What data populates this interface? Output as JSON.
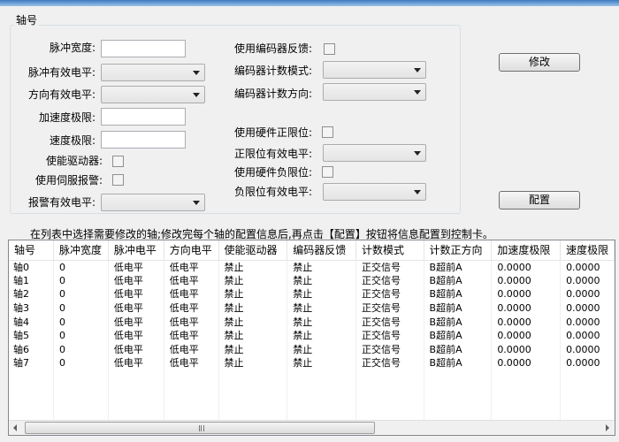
{
  "group": {
    "title": "轴号",
    "left": {
      "pulse_width_label": "脉冲宽度:",
      "pulse_level_label": "脉冲有效电平:",
      "dir_level_label": "方向有效电平:",
      "acc_limit_label": "加速度极限:",
      "speed_limit_label": "速度极限:",
      "enable_driver_label": "使能驱动器:",
      "servo_alarm_label": "使用伺服报警:",
      "alarm_level_label": "报警有效电平:"
    },
    "right": {
      "encoder_feedback_label": "使用编码器反馈:",
      "encoder_mode_label": "编码器计数模式:",
      "encoder_dir_label": "编码器计数方向:",
      "hw_pos_limit_label": "使用硬件正限位:",
      "pos_limit_level_label": "正限位有效电平:",
      "hw_neg_limit_label": "使用硬件负限位:",
      "neg_limit_level_label": "负限位有效电平:"
    }
  },
  "buttons": {
    "modify": "修改",
    "configure": "配置"
  },
  "hint": "在列表中选择需要修改的轴;修改完每个轴的配置信息后,再点击【配置】按钮将信息配置到控制卡。",
  "table": {
    "columns": [
      "轴号",
      "脉冲宽度",
      "脉冲电平",
      "方向电平",
      "使能驱动器",
      "编码器反馈",
      "计数模式",
      "计数正方向",
      "加速度极限",
      "速度极限"
    ],
    "rows": [
      [
        "轴0",
        "0",
        "低电平",
        "低电平",
        "禁止",
        "禁止",
        "正交信号",
        "B超前A",
        "0.0000",
        "0.0000"
      ],
      [
        "轴1",
        "0",
        "低电平",
        "低电平",
        "禁止",
        "禁止",
        "正交信号",
        "B超前A",
        "0.0000",
        "0.0000"
      ],
      [
        "轴2",
        "0",
        "低电平",
        "低电平",
        "禁止",
        "禁止",
        "正交信号",
        "B超前A",
        "0.0000",
        "0.0000"
      ],
      [
        "轴3",
        "0",
        "低电平",
        "低电平",
        "禁止",
        "禁止",
        "正交信号",
        "B超前A",
        "0.0000",
        "0.0000"
      ],
      [
        "轴4",
        "0",
        "低电平",
        "低电平",
        "禁止",
        "禁止",
        "正交信号",
        "B超前A",
        "0.0000",
        "0.0000"
      ],
      [
        "轴5",
        "0",
        "低电平",
        "低电平",
        "禁止",
        "禁止",
        "正交信号",
        "B超前A",
        "0.0000",
        "0.0000"
      ],
      [
        "轴6",
        "0",
        "低电平",
        "低电平",
        "禁止",
        "禁止",
        "正交信号",
        "B超前A",
        "0.0000",
        "0.0000"
      ],
      [
        "轴7",
        "0",
        "低电平",
        "低电平",
        "禁止",
        "禁止",
        "正交信号",
        "B超前A",
        "0.0000",
        "0.0000"
      ]
    ]
  },
  "scrollbar": {
    "grip_icon": "scrollbar-grip-icon"
  },
  "colors": {
    "background": "#f0f0f0",
    "titlebar": "#3b7bbf"
  }
}
